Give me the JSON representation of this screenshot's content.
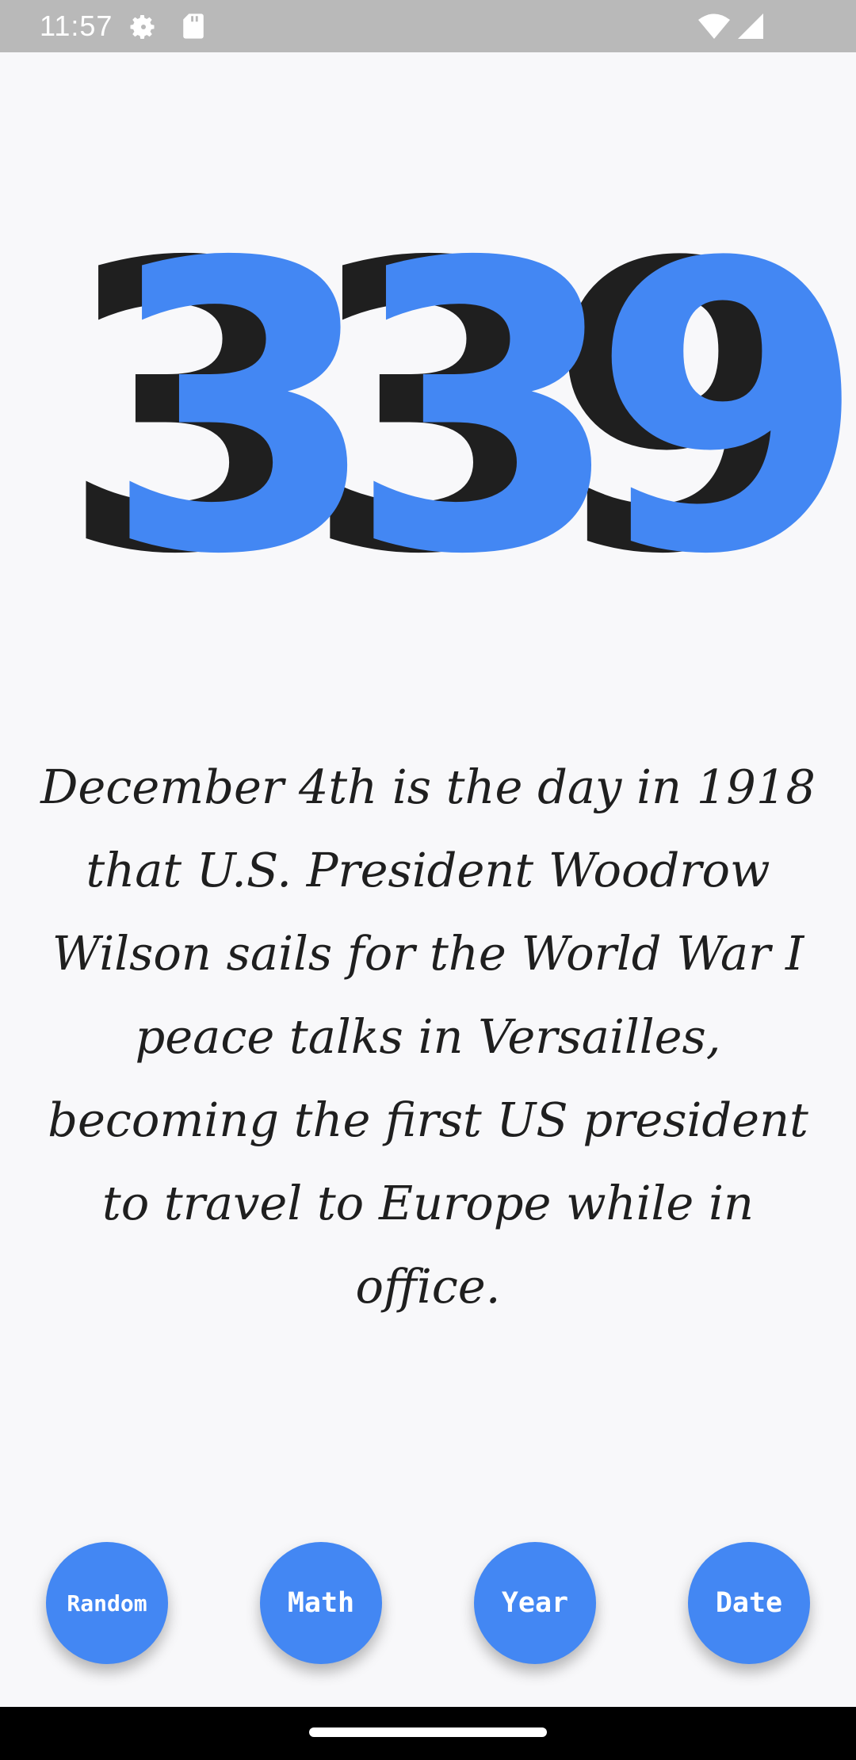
{
  "status_bar": {
    "time": "11:57",
    "left_icons": [
      "settings-icon",
      "sd-card-icon"
    ],
    "right_icons": [
      "wifi-icon",
      "signal-icon"
    ]
  },
  "number": {
    "value": "339",
    "colors": {
      "shadow": "#1f1f1f",
      "fill": "#4387f3"
    }
  },
  "fact": {
    "text": "December 4th is the day in 1918 that U.S. President Woodrow Wilson sails for the World War I peace talks in Versailles, becoming the first US president to travel to Europe while in office."
  },
  "buttons": [
    {
      "label": "Random"
    },
    {
      "label": "Math"
    },
    {
      "label": "Year"
    },
    {
      "label": "Date"
    }
  ],
  "theme": {
    "accent": "#4387f3",
    "background": "#f8f8fa"
  }
}
